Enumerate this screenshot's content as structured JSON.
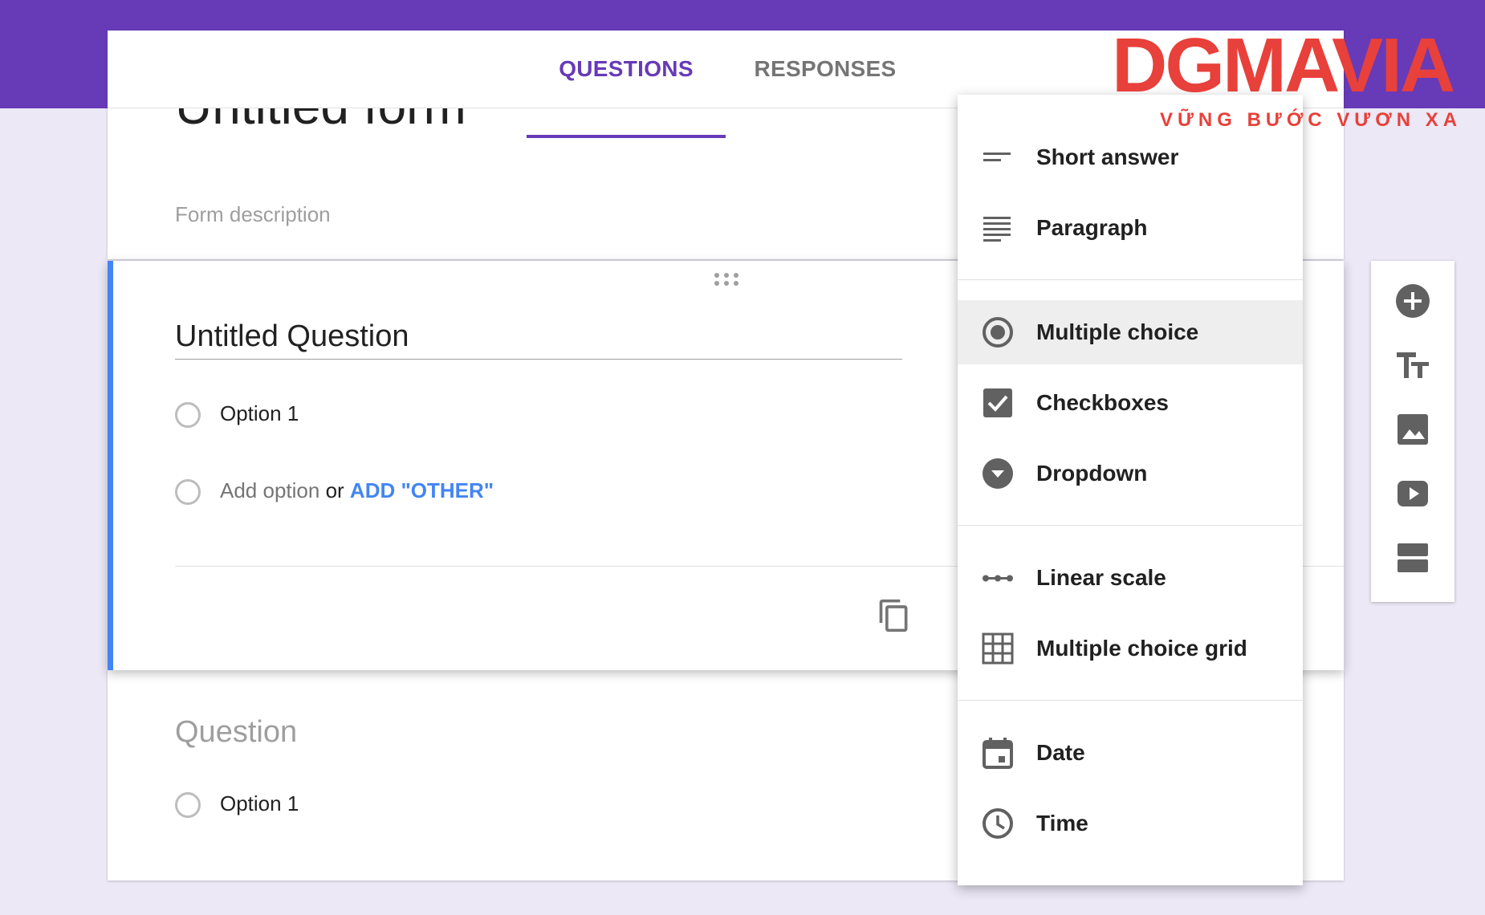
{
  "tabs": {
    "questions": "QUESTIONS",
    "responses": "RESPONSES"
  },
  "form": {
    "title": "Untitled form",
    "description": "Form description"
  },
  "active_question": {
    "title": "Untitled Question",
    "option_1": "Option 1",
    "add_option": "Add option",
    "or": "or",
    "add_other": "ADD \"OTHER\""
  },
  "next_question": {
    "title": "Question",
    "option_1": "Option 1"
  },
  "type_menu": {
    "items": [
      {
        "label": "Short answer",
        "icon": "short-answer-icon"
      },
      {
        "label": "Paragraph",
        "icon": "paragraph-icon"
      },
      {
        "label": "Multiple choice",
        "icon": "radio-selected-icon",
        "selected": true
      },
      {
        "label": "Checkboxes",
        "icon": "checkbox-checked-icon"
      },
      {
        "label": "Dropdown",
        "icon": "dropdown-circle-icon"
      },
      {
        "label": "Linear scale",
        "icon": "linear-scale-icon"
      },
      {
        "label": "Multiple choice grid",
        "icon": "grid-icon"
      },
      {
        "label": "Date",
        "icon": "calendar-icon"
      },
      {
        "label": "Time",
        "icon": "clock-icon"
      }
    ]
  },
  "toolbar": {
    "buttons": [
      "add-question-icon",
      "add-title-icon",
      "add-image-icon",
      "add-video-icon",
      "add-section-icon"
    ]
  },
  "watermark": {
    "brand": "DGMAVIA",
    "tagline": "VỮNG BƯỚC VƯƠN XA"
  },
  "colors": {
    "header": "#673ab7",
    "accent": "#4285f4",
    "icon": "#616161",
    "logo": "#e8403a"
  }
}
